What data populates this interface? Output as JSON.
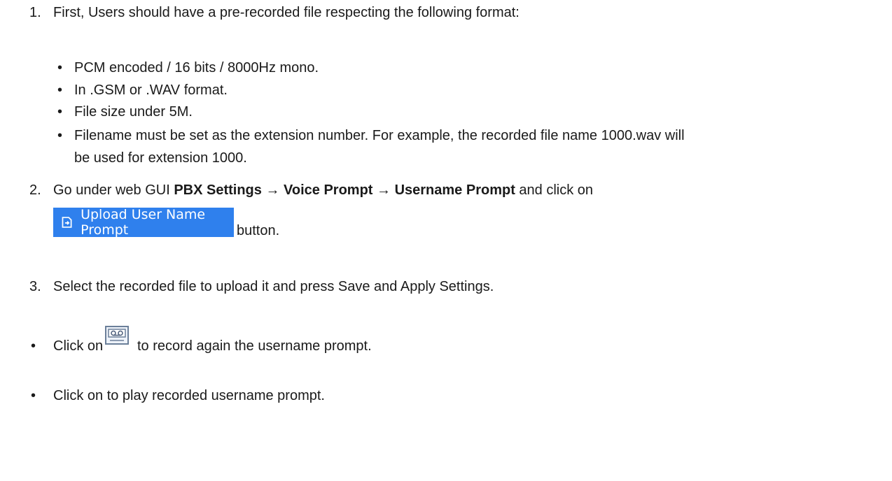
{
  "step1": {
    "number": "1.",
    "text": "First, Users should have a pre-recorded file respecting the following format:",
    "bullets": [
      "PCM encoded / 16 bits / 8000Hz mono.",
      "In .GSM or .WAV format.",
      "File size under 5M.",
      "Filename must be set as the extension number. For example, the recorded file name 1000.wav will",
      "be used for extension 1000."
    ]
  },
  "step2": {
    "number": "2.",
    "prefix": "Go under web GUI ",
    "path1": "PBX Settings",
    "arrow": " → ",
    "path2": "Voice Prompt",
    "path3": "Username Prompt",
    "suffix": " and click on",
    "button_label": "Upload User Name Prompt",
    "after_button": "button."
  },
  "step3": {
    "number": "3.",
    "text": "Select the recorded file to upload it and press Save and Apply Settings."
  },
  "notes": {
    "record_prefix": "Click on",
    "record_suffix": "to record again the username prompt.",
    "play_text": "Click on to play recorded username prompt."
  },
  "icons": {
    "bullet": "•",
    "upload_icon": "upload-icon",
    "record_icon": "cassette-record-icon"
  },
  "colors": {
    "button_bg": "#2f80ed",
    "text": "#1a1a1a"
  }
}
